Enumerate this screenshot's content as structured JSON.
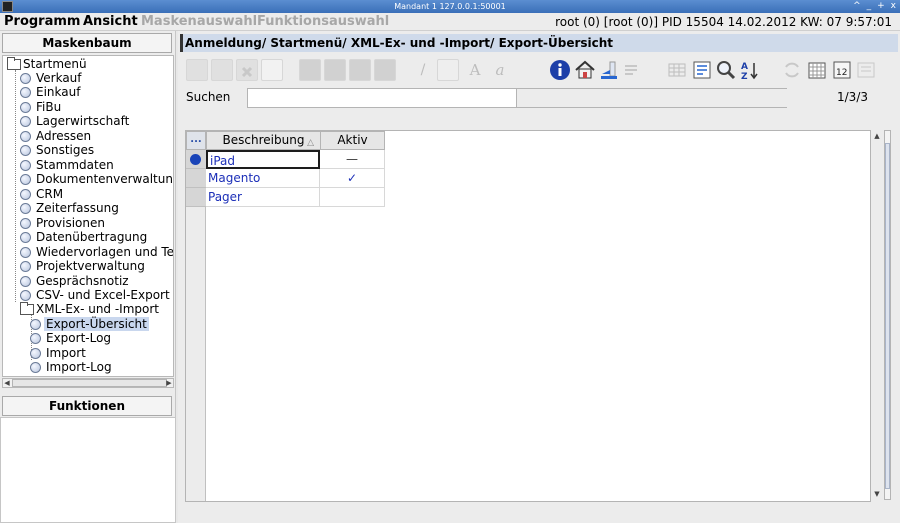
{
  "window": {
    "title": "Mandant 1 127.0.0.1:50001",
    "controls": [
      "^",
      "_",
      "+",
      "x"
    ]
  },
  "menubar": {
    "items": [
      {
        "label": "Programm",
        "enabled": true
      },
      {
        "label": "Ansicht",
        "enabled": true
      },
      {
        "label": "Maskenauswahl",
        "enabled": false
      },
      {
        "label": "Funktionsauswahl",
        "enabled": false
      }
    ],
    "status": "root (0) [root (0)] PID 15504 14.02.2012 KW: 07  9:57:01"
  },
  "sidebar": {
    "tree_header": "Maskenbaum",
    "functions_header": "Funktionen",
    "root": "Startmenü",
    "items": [
      "Verkauf",
      "Einkauf",
      "FiBu",
      "Lagerwirtschaft",
      "Adressen",
      "Sonstiges",
      "Stammdaten",
      "Dokumentenverwaltung",
      "CRM",
      "Zeiterfassung",
      "Provisionen",
      "Datenübertragung",
      "Wiedervorlagen und Ter",
      "Projektverwaltung",
      "Gesprächsnotiz",
      "CSV- und Excel-Export"
    ],
    "open_folder": "XML-Ex- und -Import",
    "subitems": [
      "Export-Übersicht",
      "Export-Log",
      "Import",
      "Import-Log"
    ],
    "selected": "Export-Übersicht"
  },
  "main": {
    "breadcrumb": "Anmeldung/ Startmenü/ XML-Ex- und -Import/ Export-Übersicht",
    "search_label": "Suchen",
    "search_value": "",
    "record_count": "1/3/3",
    "toolbar_icons": [
      "new-record-icon",
      "insert-icon",
      "delete-icon",
      "blank-icon",
      "first-record-icon",
      "prev-record-icon",
      "next-record-icon",
      "last-record-icon",
      "edit-icon",
      "copy-icon",
      "font-icon",
      "font-alt-icon",
      "info-icon",
      "home-icon",
      "back-icon",
      "forward-icon",
      "table-view-icon",
      "form-view-icon",
      "search-icon",
      "sort-az-icon",
      "refresh-icon",
      "calendar-icon",
      "number-12-icon",
      "layout-icon"
    ],
    "table": {
      "corner": "...",
      "columns": [
        "Beschreibung",
        "Aktiv"
      ],
      "rows": [
        {
          "beschreibung": "iPad",
          "aktiv": "—"
        },
        {
          "beschreibung": "Magento",
          "aktiv": "✓"
        },
        {
          "beschreibung": "Pager",
          "aktiv": ""
        }
      ]
    }
  },
  "colors": {
    "accent": "#1a44b8",
    "breadcrumb_bg": "#cfdaea",
    "selection": "#c9d7ee"
  }
}
